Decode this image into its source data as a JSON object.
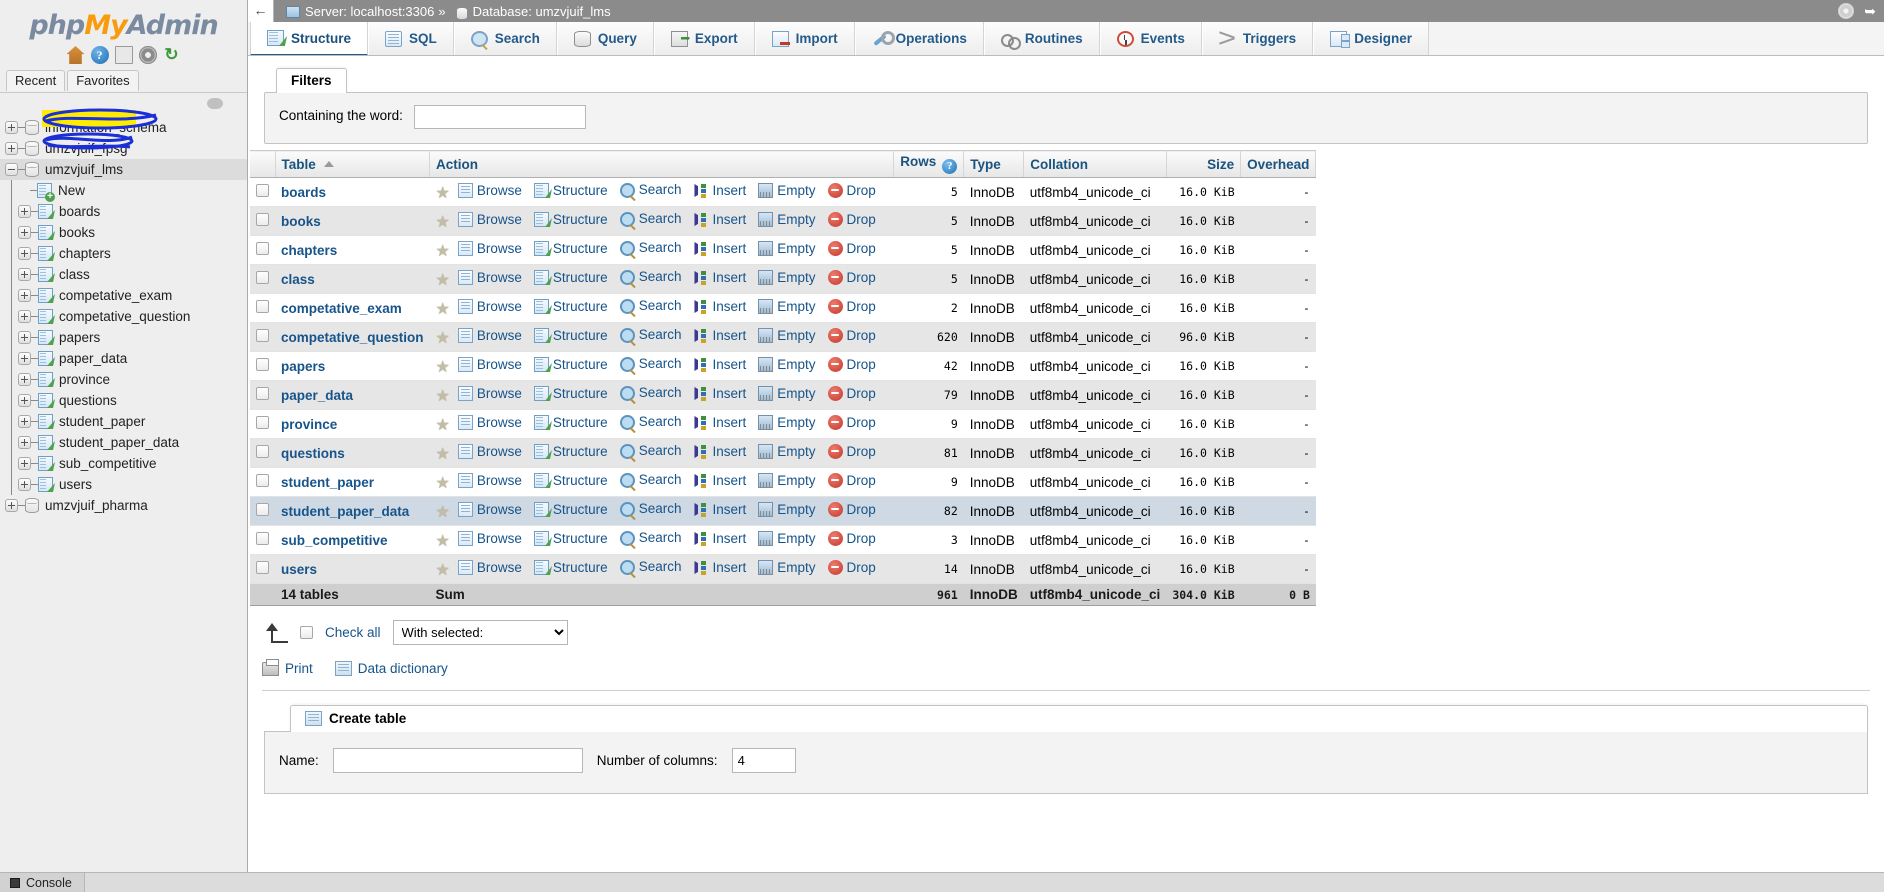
{
  "brand": {
    "php": "php",
    "my": "My",
    "admin": "Admin"
  },
  "sidebar": {
    "icons": [
      {
        "name": "home-icon",
        "label": "Home"
      },
      {
        "name": "help-icon",
        "label": "?"
      },
      {
        "name": "docs-icon",
        "label": "Documentation"
      },
      {
        "name": "settings-icon",
        "label": "Settings"
      },
      {
        "name": "reload-icon",
        "label": "↻"
      }
    ],
    "tabs": [
      "Recent",
      "Favorites"
    ],
    "databases": [
      {
        "name": "information_schema",
        "expanded": false,
        "selected": false,
        "annotated": true
      },
      {
        "name": "umzvjuif_fpsg",
        "expanded": false,
        "selected": false,
        "annotated": true
      },
      {
        "name": "umzvjuif_lms",
        "expanded": true,
        "selected": true,
        "annotated": false
      },
      {
        "name": "umzvjuif_pharma",
        "expanded": false,
        "selected": false,
        "annotated": false
      }
    ],
    "new_label": "New",
    "tables": [
      "boards",
      "books",
      "chapters",
      "class",
      "competative_exam",
      "competative_question",
      "papers",
      "paper_data",
      "province",
      "questions",
      "student_paper",
      "student_paper_data",
      "sub_competitive",
      "users"
    ]
  },
  "topbar": {
    "back_label": "←",
    "server_label": "Server: localhost:3306",
    "separator": "»",
    "database_label": "Database: umzvjuif_lms",
    "gear_name": "settings-gear",
    "exit_name": "exit-icon"
  },
  "nav_tabs": [
    {
      "label": "Structure",
      "icon": "structure-icon",
      "active": true
    },
    {
      "label": "SQL",
      "icon": "sql-icon",
      "active": false
    },
    {
      "label": "Search",
      "icon": "search-icon",
      "active": false
    },
    {
      "label": "Query",
      "icon": "query-icon",
      "active": false
    },
    {
      "label": "Export",
      "icon": "export-icon",
      "active": false
    },
    {
      "label": "Import",
      "icon": "import-icon",
      "active": false
    },
    {
      "label": "Operations",
      "icon": "operations-icon",
      "active": false
    },
    {
      "label": "Routines",
      "icon": "routines-icon",
      "active": false
    },
    {
      "label": "Events",
      "icon": "events-icon",
      "active": false
    },
    {
      "label": "Triggers",
      "icon": "triggers-icon",
      "active": false
    },
    {
      "label": "Designer",
      "icon": "designer-icon",
      "active": false
    }
  ],
  "filters": {
    "legend": "Filters",
    "containing_label": "Containing the word:",
    "containing_value": "",
    "containing_placeholder": ""
  },
  "table": {
    "headers": {
      "table": "Table",
      "action": "Action",
      "rows": "Rows",
      "type": "Type",
      "collation": "Collation",
      "size": "Size",
      "overhead": "Overhead"
    },
    "actions": [
      "Browse",
      "Structure",
      "Search",
      "Insert",
      "Empty",
      "Drop"
    ],
    "rows": [
      {
        "name": "boards",
        "rows": "5",
        "type": "InnoDB",
        "collation": "utf8mb4_unicode_ci",
        "size": "16.0 KiB",
        "overhead": "-"
      },
      {
        "name": "books",
        "rows": "5",
        "type": "InnoDB",
        "collation": "utf8mb4_unicode_ci",
        "size": "16.0 KiB",
        "overhead": "-"
      },
      {
        "name": "chapters",
        "rows": "5",
        "type": "InnoDB",
        "collation": "utf8mb4_unicode_ci",
        "size": "16.0 KiB",
        "overhead": "-"
      },
      {
        "name": "class",
        "rows": "5",
        "type": "InnoDB",
        "collation": "utf8mb4_unicode_ci",
        "size": "16.0 KiB",
        "overhead": "-"
      },
      {
        "name": "competative_exam",
        "rows": "2",
        "type": "InnoDB",
        "collation": "utf8mb4_unicode_ci",
        "size": "16.0 KiB",
        "overhead": "-"
      },
      {
        "name": "competative_question",
        "rows": "620",
        "type": "InnoDB",
        "collation": "utf8mb4_unicode_ci",
        "size": "96.0 KiB",
        "overhead": "-"
      },
      {
        "name": "papers",
        "rows": "42",
        "type": "InnoDB",
        "collation": "utf8mb4_unicode_ci",
        "size": "16.0 KiB",
        "overhead": "-"
      },
      {
        "name": "paper_data",
        "rows": "79",
        "type": "InnoDB",
        "collation": "utf8mb4_unicode_ci",
        "size": "16.0 KiB",
        "overhead": "-"
      },
      {
        "name": "province",
        "rows": "9",
        "type": "InnoDB",
        "collation": "utf8mb4_unicode_ci",
        "size": "16.0 KiB",
        "overhead": "-"
      },
      {
        "name": "questions",
        "rows": "81",
        "type": "InnoDB",
        "collation": "utf8mb4_unicode_ci",
        "size": "16.0 KiB",
        "overhead": "-"
      },
      {
        "name": "student_paper",
        "rows": "9",
        "type": "InnoDB",
        "collation": "utf8mb4_unicode_ci",
        "size": "16.0 KiB",
        "overhead": "-"
      },
      {
        "name": "student_paper_data",
        "rows": "82",
        "type": "InnoDB",
        "collation": "utf8mb4_unicode_ci",
        "size": "16.0 KiB",
        "overhead": "-",
        "highlighted": true
      },
      {
        "name": "sub_competitive",
        "rows": "3",
        "type": "InnoDB",
        "collation": "utf8mb4_unicode_ci",
        "size": "16.0 KiB",
        "overhead": "-"
      },
      {
        "name": "users",
        "rows": "14",
        "type": "InnoDB",
        "collation": "utf8mb4_unicode_ci",
        "size": "16.0 KiB",
        "overhead": "-"
      }
    ],
    "sum": {
      "count_label": "14 tables",
      "sum_label": "Sum",
      "rows": "961",
      "type": "InnoDB",
      "collation": "utf8mb4_unicode_ci",
      "size": "304.0 KiB",
      "overhead": "0 B"
    }
  },
  "bottom": {
    "check_all": "Check all",
    "with_selected_label": "With selected:",
    "with_selected_options": [
      "With selected:"
    ],
    "print": "Print",
    "data_dictionary": "Data dictionary"
  },
  "create": {
    "legend": "Create table",
    "name_label": "Name:",
    "name_value": "",
    "columns_label": "Number of columns:",
    "columns_value": "4"
  },
  "console": {
    "label": "Console"
  }
}
